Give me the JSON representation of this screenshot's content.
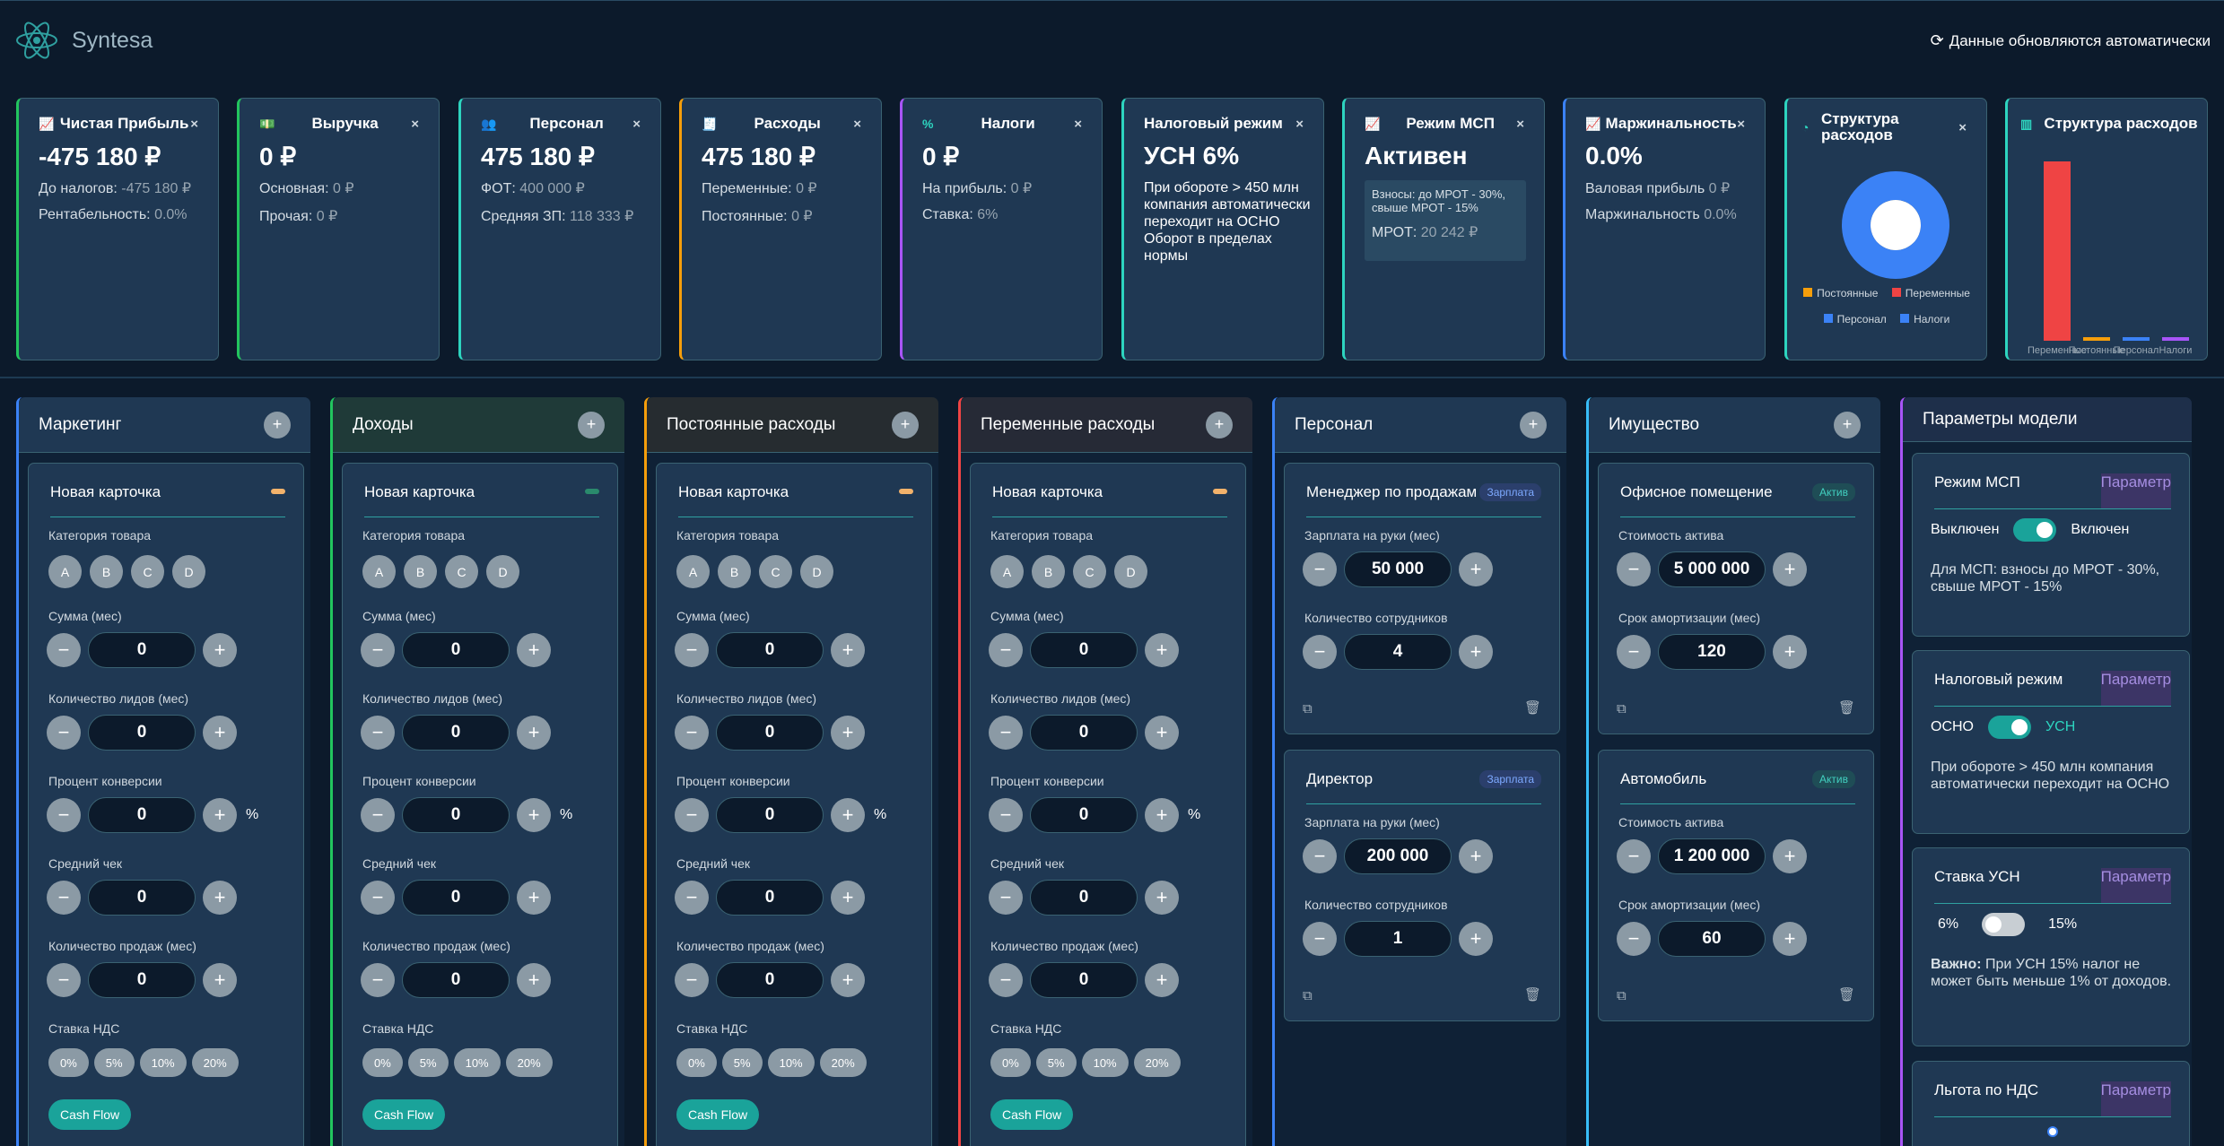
{
  "app": {
    "name": "Syntesa",
    "refresh": "Данные обновляются автоматически"
  },
  "kpis": [
    {
      "title": "Чистая Прибыль",
      "value": "-475 180 ₽",
      "l1": "До налогов: ",
      "v1": "-475 180 ₽",
      "l2": "Рентабельность: ",
      "v2": "0.0%",
      "icon": "line-chart-icon",
      "accent": "#22c55e"
    },
    {
      "title": "Выручка",
      "value": "0 ₽",
      "l1": "Основная: ",
      "v1": "0 ₽",
      "l2": "Прочая: ",
      "v2": "0 ₽",
      "icon": "money-icon",
      "accent": "#22c55e"
    },
    {
      "title": "Персонал",
      "value": "475 180 ₽",
      "l1": "ФОТ: ",
      "v1": "400 000 ₽",
      "l2": "Средняя ЗП: ",
      "v2": "118 333 ₽",
      "icon": "users-icon",
      "accent": "#2dd4bf"
    },
    {
      "title": "Расходы",
      "value": "475 180 ₽",
      "l1": "Переменные: ",
      "v1": "0 ₽",
      "l2": "Постоянные: ",
      "v2": "0 ₽",
      "icon": "receipt-icon",
      "accent": "#f59e0b"
    },
    {
      "title": "Налоги",
      "value": "0 ₽",
      "l1": "На прибыль: ",
      "v1": "0 ₽",
      "l2": "Ставка: ",
      "v2": "6%",
      "icon": "percent-icon",
      "accent": "#a855f7"
    },
    {
      "title": "Налоговый режим",
      "value": "УСН 6%",
      "text": "При обороте > 450 млн компания автоматически переходит на ОСНО Оборот в пределах нормы",
      "accent": "#2dd4bf"
    },
    {
      "title": "Режим МСП",
      "value": "Активен",
      "msp_a": "Взносы: до МРОТ - 30%, свыше МРОТ - 15%",
      "msp_b": "МРОТ: ",
      "msp_v": "20 242 ₽",
      "icon": "line-chart-icon",
      "accent": "#2dd4bf"
    },
    {
      "title": "Маржинальность",
      "value": "0.0%",
      "l1": "Валовая прибыль ",
      "v1": "0 ₽",
      "l2": "Маржинальность ",
      "v2": "0.0%",
      "icon": "line-chart-icon",
      "accent": "#3b82f6"
    },
    {
      "title": "Структура расходов",
      "icon": "pie-chart-icon",
      "accent": "#2dd4bf"
    },
    {
      "title": "Структура расходов",
      "icon": "bar-chart-icon",
      "accent": "#2dd4bf"
    }
  ],
  "chart_data": [
    {
      "type": "pie",
      "title": "Структура расходов",
      "legend": [
        "Постоянные",
        "Переменные",
        "Персонал",
        "Налоги"
      ],
      "colors": [
        "#f59e0b",
        "#ef4444",
        "#3b82f6",
        "#3b82f6"
      ],
      "values": [
        0,
        0,
        1,
        0
      ]
    },
    {
      "type": "bar",
      "title": "Структура расходов",
      "categories": [
        "Переменные",
        "Постоянные",
        "Персонал",
        "Налоги"
      ],
      "values": [
        1,
        0.02,
        0.02,
        0.02
      ],
      "colors": [
        "#ef4444",
        "#f59e0b",
        "#3b82f6",
        "#a855f7"
      ]
    }
  ],
  "columns": [
    {
      "title": "Маркетинг",
      "accent": "#3b82f6"
    },
    {
      "title": "Доходы",
      "accent": "#22c55e"
    },
    {
      "title": "Постоянные расходы",
      "accent": "#f59e0b"
    },
    {
      "title": "Переменные расходы",
      "accent": "#ef4444"
    },
    {
      "title": "Персонал",
      "accent": "#3b82f6"
    },
    {
      "title": "Имущество",
      "accent": "#38bdf8"
    }
  ],
  "newcard": {
    "title": "Новая карточка",
    "cat_label": "Категория товара",
    "cats": [
      "A",
      "B",
      "C",
      "D"
    ],
    "sum": "Сумма (мес)",
    "leads": "Количество лидов (мес)",
    "conv": "Процент конверсии",
    "check": "Средний чек",
    "sales": "Количество продаж (мес)",
    "vat": "Ставка НДС",
    "vats": [
      "0%",
      "5%",
      "10%",
      "20%"
    ],
    "cf": "Cash Flow",
    "zero": "0",
    "pct": "%"
  },
  "staff": [
    {
      "title": "Менеджер по продажам",
      "tag": "Зарплата",
      "l1": "Зарплата на руки (мес)",
      "v1": "50 000",
      "l2": "Количество сотрудников",
      "v2": "4"
    },
    {
      "title": "Директор",
      "tag": "Зарплата",
      "l1": "Зарплата на руки (мес)",
      "v1": "200 000",
      "l2": "Количество сотрудников",
      "v2": "1"
    }
  ],
  "assets": [
    {
      "title": "Офисное помещение",
      "tag": "Актив",
      "l1": "Стоимость актива",
      "v1": "5 000 000",
      "l2": "Срок амортизации (мес)",
      "v2": "120"
    },
    {
      "title": "Автомобиль",
      "tag": "Актив",
      "l1": "Стоимость актива",
      "v1": "1 200 000",
      "l2": "Срок амортизации (мес)",
      "v2": "60"
    }
  ],
  "params": {
    "title": "Параметры модели",
    "tag": "Параметр",
    "msp": {
      "title": "Режим МСП",
      "off": "Выключен",
      "on": "Включен",
      "text": "Для МСП: взносы до МРОТ - 30%, свыше МРОТ - 15%"
    },
    "tax": {
      "title": "Налоговый режим",
      "off": "ОСНО",
      "on": "УСН",
      "text": "При обороте > 450 млн компания автоматически переходит на ОСНО"
    },
    "usn": {
      "title": "Ставка УСН",
      "off": "6%",
      "on": "15%",
      "bold": "Важно:",
      "text": " При УСН 15% налог не может быть меньше 1% от доходов."
    },
    "nds": {
      "title": "Льгота по НДС"
    }
  }
}
